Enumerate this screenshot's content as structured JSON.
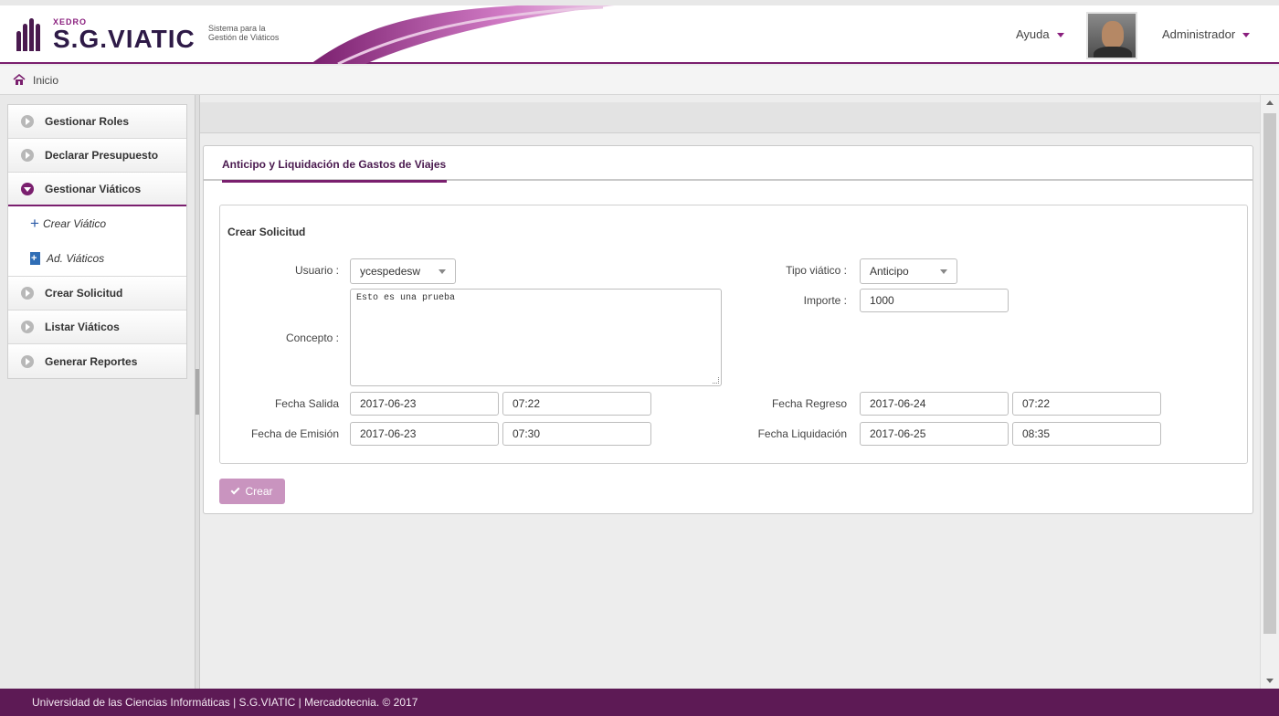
{
  "header": {
    "brand_small": "XEDRO",
    "brand_name": "S.G.VIATIC",
    "brand_subtitle_line1": "Sistema para la",
    "brand_subtitle_line2": "Gestión de Viáticos",
    "help_label": "Ayuda",
    "user_label": "Administrador"
  },
  "breadcrumb": {
    "home_label": "Inicio"
  },
  "sidebar": {
    "items": [
      {
        "label": "Gestionar Roles"
      },
      {
        "label": "Declarar Presupuesto"
      },
      {
        "label": "Gestionar Viáticos",
        "expanded": true
      },
      {
        "label": "Crear Solicitud"
      },
      {
        "label": "Listar Viáticos"
      },
      {
        "label": "Generar Reportes"
      }
    ],
    "subitems": [
      {
        "label": "Crear Viático",
        "icon": "plus-icon"
      },
      {
        "label": "Ad. Viáticos",
        "icon": "add-document-icon"
      }
    ]
  },
  "panel": {
    "tab_label": "Anticipo y Liquidación de Gastos de Viajes",
    "legend": "Crear Solicitud",
    "usuario": {
      "label": "Usuario :",
      "value": "ycespedesw"
    },
    "tipo_viatico": {
      "label": "Tipo viático :",
      "value": "Anticipo"
    },
    "concepto": {
      "label": "Concepto :",
      "value": "Esto es una prueba"
    },
    "importe": {
      "label": "Importe :",
      "value": "1000"
    },
    "fecha_salida": {
      "label": "Fecha Salida",
      "date": "2017-06-23",
      "time": "07:22"
    },
    "fecha_regreso": {
      "label": "Fecha Regreso",
      "date": "2017-06-24",
      "time": "07:22"
    },
    "fecha_emision": {
      "label": "Fecha de Emisión",
      "date": "2017-06-23",
      "time": "07:30"
    },
    "fecha_liquidacion": {
      "label": "Fecha Liquidación",
      "date": "2017-06-25",
      "time": "08:35"
    },
    "create_button": "Crear"
  },
  "footer": {
    "text": "Universidad de las Ciencias Informáticas | S.G.VIATIC | Mercadotecnia. © 2017"
  },
  "colors": {
    "brand": "#7a1f6e",
    "footer_bg": "#5d1a55",
    "button_bg": "#c994bf"
  }
}
